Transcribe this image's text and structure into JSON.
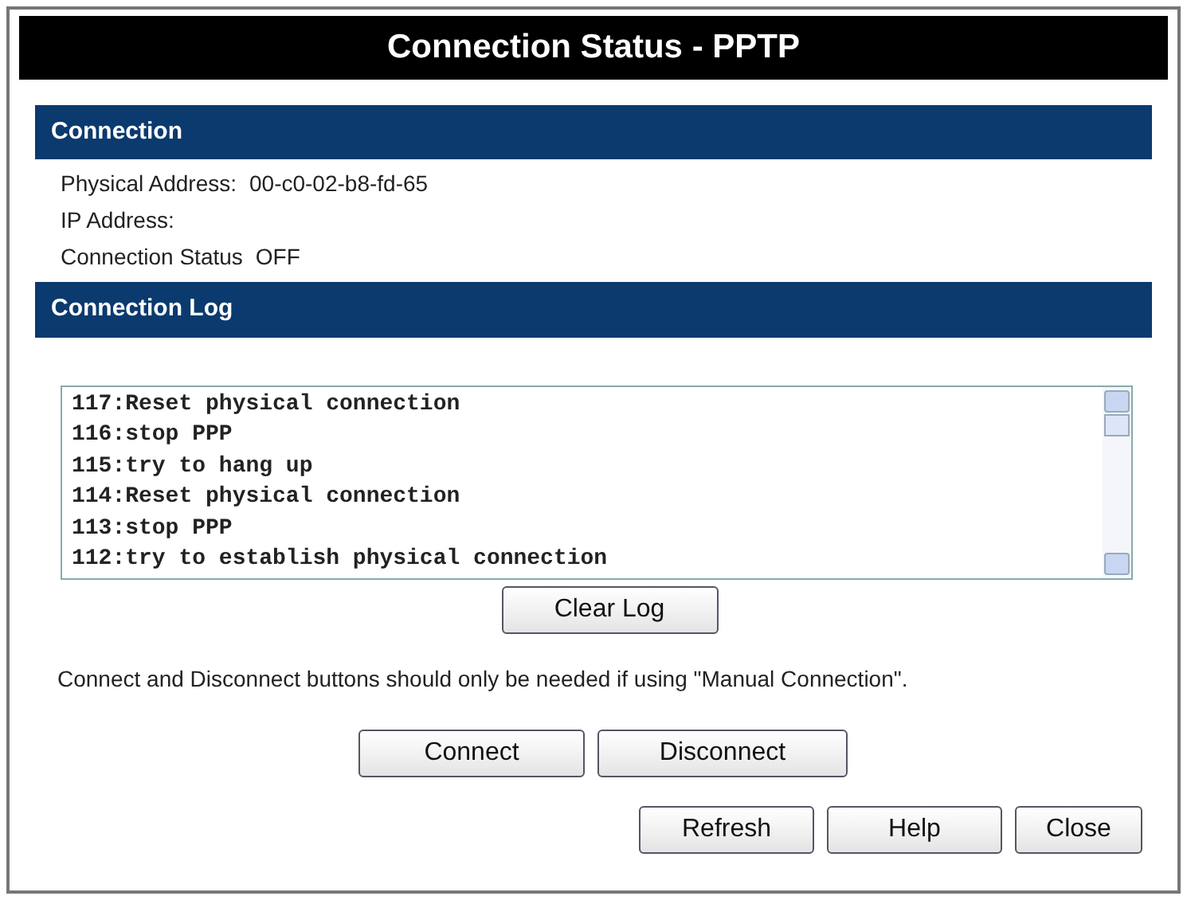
{
  "window": {
    "title": "Connection Status - PPTP"
  },
  "connection": {
    "heading": "Connection",
    "fields": [
      {
        "label": "Physical Address:",
        "value": "00-c0-02-b8-fd-65"
      },
      {
        "label": "IP Address:"
      },
      {
        "label": "Connection Status",
        "value": "OFF"
      }
    ]
  },
  "log": {
    "heading": "Connection Log",
    "lines": [
      "117:Reset physical connection",
      "116:stop PPP",
      "115:try to hang up",
      "114:Reset physical connection",
      "113:stop PPP",
      "112:try to establish physical connection"
    ],
    "clear_button": "Clear Log"
  },
  "note": "Connect and Disconnect buttons should only be needed if using \"Manual Connection\".",
  "connect_buttons": [
    "Connect",
    "Disconnect"
  ],
  "footer_buttons": [
    "Refresh",
    "Help",
    "Close"
  ]
}
